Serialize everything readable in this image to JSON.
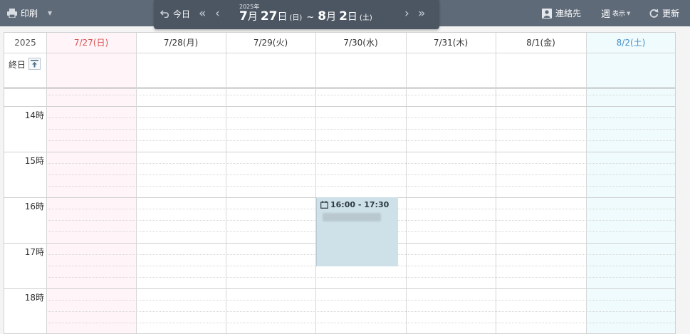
{
  "toolbar": {
    "print_label": "印刷",
    "contacts_label": "連絡先",
    "view_label": "週",
    "view_sub_label": "表示",
    "refresh_label": "更新"
  },
  "nav": {
    "today_label": "今日",
    "year_label": "2025年",
    "start_month": "7",
    "start_day": "27",
    "start_dow": "(日)",
    "end_month": "8",
    "end_day": "2",
    "end_dow": "(土)",
    "month_unit": "月",
    "day_unit": "日",
    "tilde": "~"
  },
  "calendar": {
    "year": "2025",
    "allday_label": "終日",
    "days": [
      {
        "label": "7/27(日)",
        "color": "#d9534f",
        "bg": "#fff4f8"
      },
      {
        "label": "7/28(月)",
        "color": "#333333",
        "bg": "#ffffff"
      },
      {
        "label": "7/29(火)",
        "color": "#333333",
        "bg": "#ffffff"
      },
      {
        "label": "7/30(水)",
        "color": "#333333",
        "bg": "#ffffff"
      },
      {
        "label": "7/31(木)",
        "color": "#333333",
        "bg": "#ffffff"
      },
      {
        "label": "8/1(金)",
        "color": "#333333",
        "bg": "#ffffff"
      },
      {
        "label": "8/2(土)",
        "color": "#4a90c8",
        "bg": "#effbfc"
      }
    ],
    "hours": [
      "14時",
      "15時",
      "16時",
      "17時",
      "18時"
    ],
    "event": {
      "time": "16:00 - 17:30",
      "day": "7/30(水)",
      "start": "16:00",
      "end": "17:30"
    }
  },
  "colors": {
    "topbar": "#5f6a78",
    "navbox": "#4c5663",
    "event_bg": "#cfe1e8",
    "sunday": "#d9534f",
    "saturday": "#4a90c8"
  }
}
